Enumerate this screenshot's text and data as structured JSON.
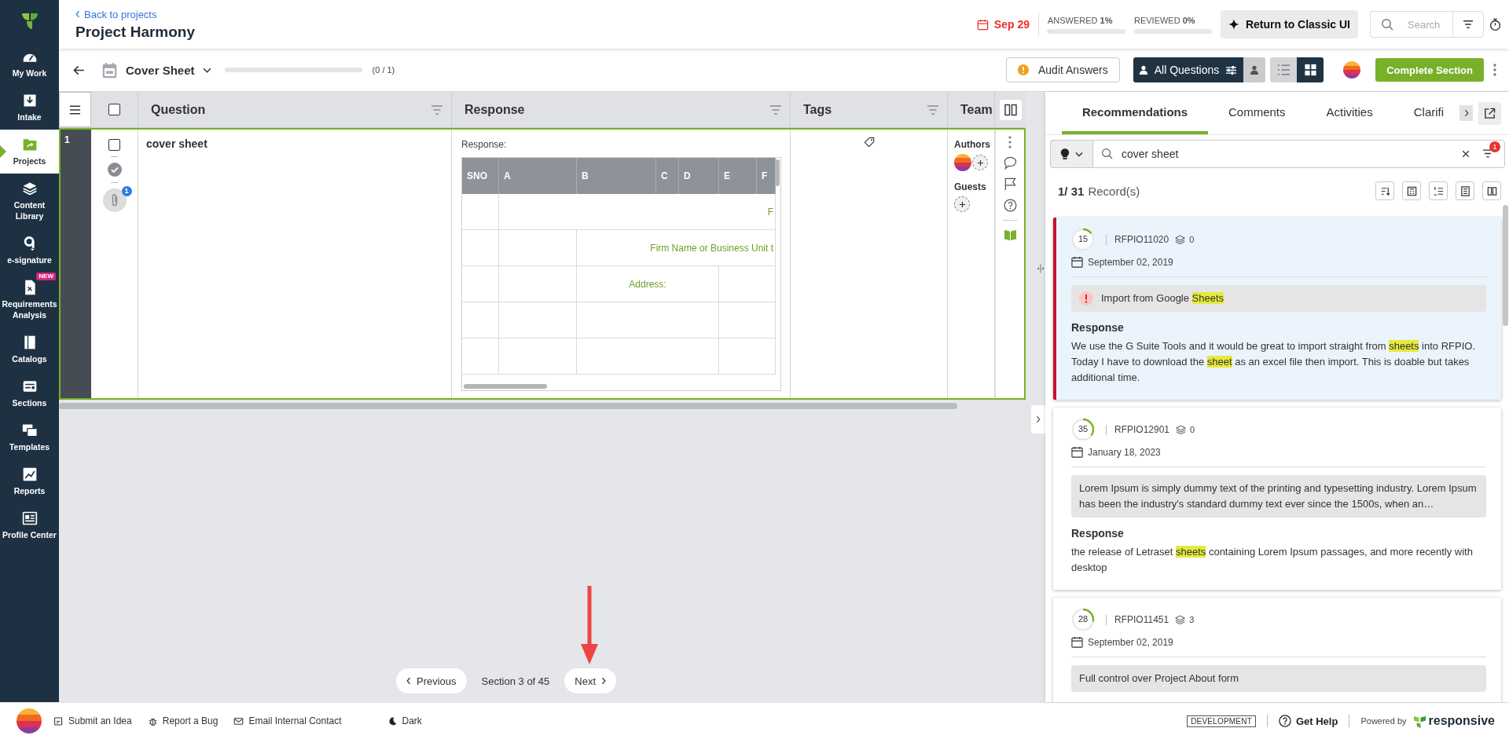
{
  "sidebar": {
    "items": [
      {
        "label": "My Work",
        "selected": false
      },
      {
        "label": "Intake",
        "selected": false
      },
      {
        "label": "Projects",
        "selected": true
      },
      {
        "label": "Content Library",
        "selected": false
      },
      {
        "label": "e-signature",
        "selected": false
      },
      {
        "label": "Requirements Analysis",
        "selected": false,
        "badge": "NEW"
      },
      {
        "label": "Catalogs",
        "selected": false
      },
      {
        "label": "Sections",
        "selected": false
      },
      {
        "label": "Templates",
        "selected": false
      },
      {
        "label": "Reports",
        "selected": false
      },
      {
        "label": "Profile Center",
        "selected": false
      }
    ]
  },
  "header": {
    "back_link": "Back to projects",
    "title": "Project Harmony",
    "due_date": "Sep 29",
    "progress": [
      {
        "label": "ANSWERED **1%**",
        "level": 0.01
      },
      {
        "label": "REVIEWED **0%**",
        "level": 0
      }
    ],
    "classic_button": "Return to Classic UI",
    "search": {
      "placeholder": "Search"
    }
  },
  "toolbar": {
    "section": "Cover Sheet",
    "level": 0,
    "count": "(0 / 1)",
    "audit_button": "Audit Answers",
    "filter_toggle": [
      {
        "label": "All Questions",
        "selected": true
      },
      {
        "selected": false
      }
    ],
    "view_toggle": [
      {
        "kind": "list",
        "selected": false
      },
      {
        "kind": "grid",
        "selected": true
      }
    ],
    "complete_button": "Complete Section"
  },
  "table": {
    "all_checked": false,
    "columns": [
      {
        "label": "Question",
        "filter": true
      },
      {
        "label": "Response",
        "filter": true
      },
      {
        "label": "Tags",
        "filter": true
      },
      {
        "label": "Team",
        "filter": false
      }
    ],
    "rows": [
      {
        "number": "1",
        "checked": false,
        "question": "cover sheet",
        "attachments": "1",
        "response_label": "Response:",
        "sheet": {
          "columns": [
            "SNO",
            "A",
            "B",
            "C",
            "D",
            "E",
            "F"
          ],
          "texts": [
            "F",
            "Firm Name or Business Unit t",
            "Address:"
          ]
        },
        "authors_label": "Authors",
        "guests_label": "Guests"
      }
    ]
  },
  "pager": {
    "previous": "Previous",
    "label": "Section 3 of 45",
    "next": "Next"
  },
  "panel": {
    "tabs": [
      {
        "label": "Recommendations",
        "selected": true
      },
      {
        "label": "Comments",
        "selected": false
      },
      {
        "label": "Activities",
        "selected": false
      },
      {
        "label": "Clarifi",
        "selected": false
      }
    ],
    "search": {
      "value": "cover sheet",
      "filter_count": "1"
    },
    "records": {
      "position": "1/ 31",
      "label": "Record(s)"
    },
    "cards": [
      {
        "selected": true,
        "score": "15",
        "level": 0.15,
        "id": "RFPIO11020",
        "uses": "0",
        "date": "September 02, 2019",
        "alert": true,
        "question": [
          {
            "text": "Import from Google ",
            "highlight": false
          },
          {
            "text": "Sheets",
            "highlight": true
          }
        ],
        "response_label": "Response",
        "response": [
          {
            "text": "We use the G Suite Tools and it would be great to import straight from ",
            "highlight": false
          },
          {
            "text": "sheets",
            "highlight": true
          },
          {
            "text": " into RFPIO. Today I have to download the ",
            "highlight": false
          },
          {
            "text": "sheet",
            "highlight": true
          },
          {
            "text": " as an excel file then import. This is doable but takes additional time.",
            "highlight": false
          }
        ]
      },
      {
        "selected": false,
        "score": "35",
        "level": 0.35,
        "id": "RFPIO12901",
        "uses": "0",
        "date": "January 18, 2023",
        "alert": false,
        "question": [
          {
            "text": "Lorem Ipsum is simply dummy text of the printing and typesetting industry. Lorem Ipsum has been the industry's standard dummy text ever since the 1500s, when an…",
            "highlight": false
          }
        ],
        "response_label": "Response",
        "response": [
          {
            "text": "the release of Letraset ",
            "highlight": false
          },
          {
            "text": "sheets",
            "highlight": true
          },
          {
            "text": " containing Lorem Ipsum passages, and more recently with desktop",
            "highlight": false
          }
        ]
      },
      {
        "selected": false,
        "score": "28",
        "level": 0.28,
        "id": "RFPIO11451",
        "uses": "3",
        "date": "September 02, 2019",
        "alert": false,
        "question": [
          {
            "text": "Full control over Project About form",
            "highlight": false
          }
        ]
      }
    ]
  },
  "footer": {
    "links": [
      "Submit an Idea",
      "Report a Bug",
      "Email Internal Contact",
      "Dark"
    ],
    "environment": "DEVELOPMENT",
    "help": "Get Help",
    "powered_by": "Powered by",
    "brand": "responsive"
  }
}
